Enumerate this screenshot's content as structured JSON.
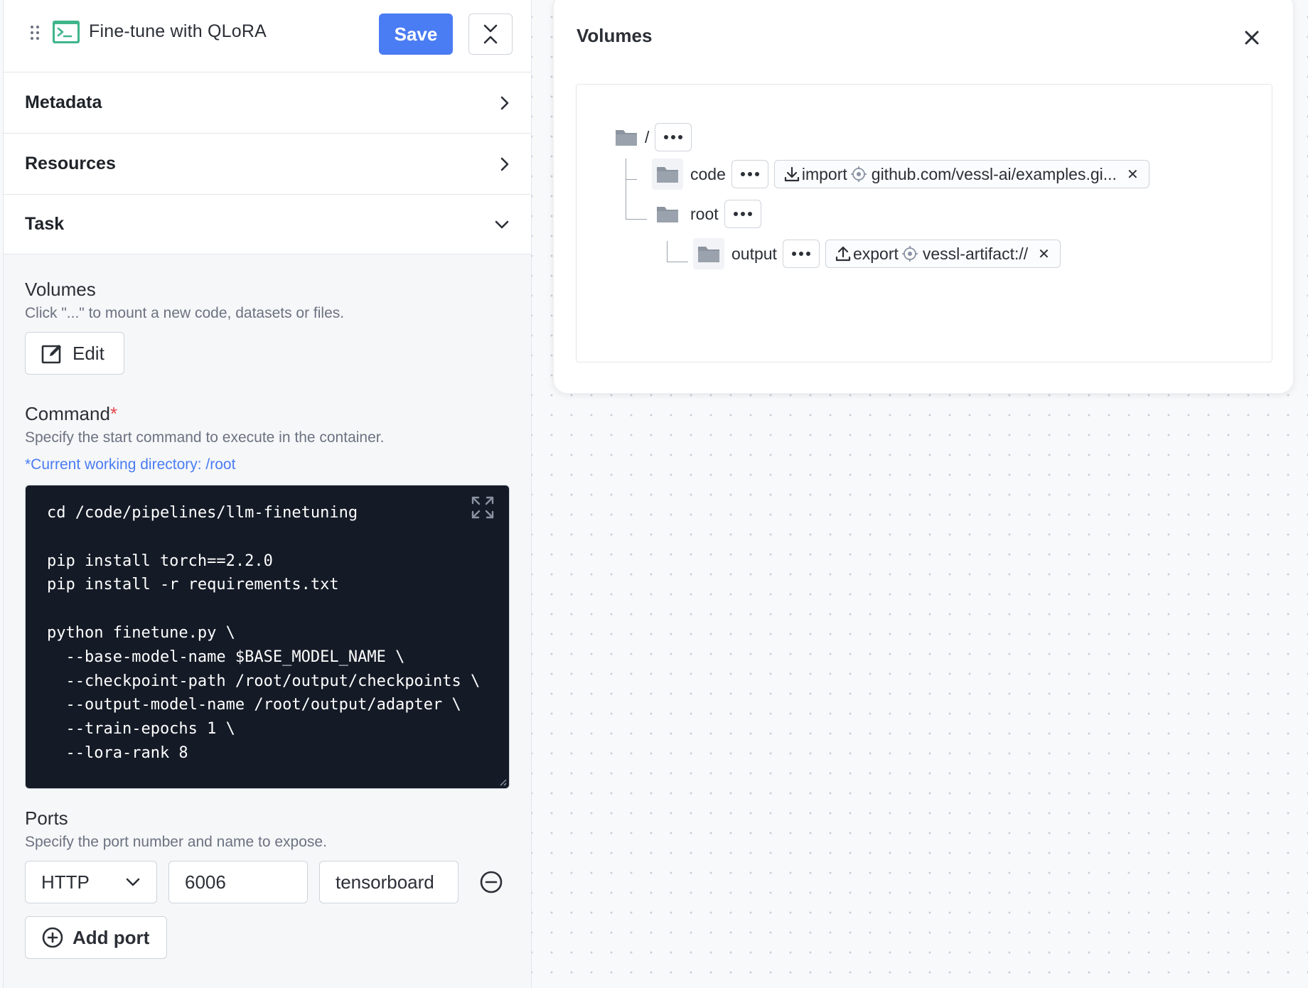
{
  "header": {
    "title": "Fine-tune with QLoRA",
    "save_label": "Save"
  },
  "sections": {
    "metadata": "Metadata",
    "resources": "Resources",
    "task": "Task"
  },
  "volumes_field": {
    "title": "Volumes",
    "description": "Click \"...\" to mount a new code, datasets or files.",
    "edit_label": "Edit"
  },
  "command_field": {
    "title": "Command",
    "required_mark": "*",
    "description": "Specify the start command to execute in the container.",
    "working_dir": "*Current working directory: /root",
    "code": "cd /code/pipelines/llm-finetuning\n\npip install torch==2.2.0\npip install -r requirements.txt\n\npython finetune.py \\\n  --base-model-name $BASE_MODEL_NAME \\\n  --checkpoint-path /root/output/checkpoints \\\n  --output-model-name /root/output/adapter \\\n  --train-epochs 1 \\\n  --lora-rank 8"
  },
  "ports_field": {
    "title": "Ports",
    "description": "Specify the port number and name to expose.",
    "protocol": "HTTP",
    "port": "6006",
    "name": "tensorboard",
    "add_label": "Add port"
  },
  "volumes_panel": {
    "title": "Volumes",
    "root_name": "/",
    "code": {
      "name": "code",
      "mode": "import",
      "source": "github.com/vessl-ai/examples.gi..."
    },
    "root": {
      "name": "root"
    },
    "output": {
      "name": "output",
      "mode": "export",
      "source": "vessl-artifact://"
    }
  },
  "colors": {
    "primary": "#4a7cf3",
    "required": "#e5484d",
    "code_bg": "#141a26",
    "terminal_icon": "#3fb58b"
  }
}
